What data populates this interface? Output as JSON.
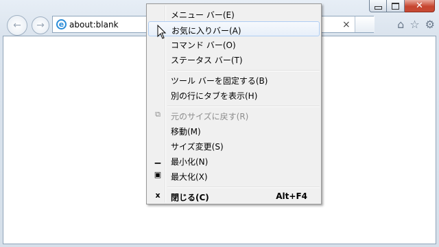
{
  "browser": {
    "address": "about:blank",
    "clear_glyph": "×"
  },
  "menu": {
    "items": [
      {
        "label": "メニュー バー(E)"
      },
      {
        "label": "お気に入りバー(A)"
      },
      {
        "label": "コマンド バー(O)"
      },
      {
        "label": "ステータス バー(T)"
      },
      {
        "label": "ツール バーを固定する(B)"
      },
      {
        "label": "別の行にタブを表示(H)"
      },
      {
        "label": "元のサイズに戻す(R)"
      },
      {
        "label": "移動(M)"
      },
      {
        "label": "サイズ変更(S)"
      },
      {
        "label": "最小化(N)"
      },
      {
        "label": "最大化(X)"
      },
      {
        "label": "閉じる(C)",
        "accelerator": "Alt+F4"
      }
    ]
  },
  "icons": [
    "minimize-icon",
    "maximize-icon",
    "close-icon",
    "back-icon",
    "forward-icon",
    "ie-icon",
    "clear-icon",
    "home-icon",
    "favorites-icon",
    "settings-icon",
    "restore-icon",
    "cursor-icon"
  ]
}
